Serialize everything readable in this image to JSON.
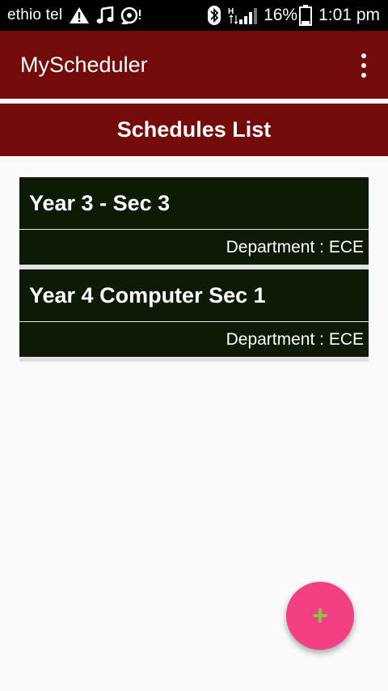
{
  "status_bar": {
    "carrier": "ethio tel",
    "network_type": "H",
    "battery_percent": "16%",
    "time": "1:01 pm",
    "icons": [
      "warning-icon",
      "music-icon",
      "sync-icon",
      "bluetooth-icon",
      "signal-icon",
      "battery-icon"
    ]
  },
  "app_bar": {
    "title": "MyScheduler",
    "overflow_icon": "more-vertical-icon"
  },
  "section": {
    "title": "Schedules List"
  },
  "schedules": [
    {
      "title": "Year 3 - Sec 3",
      "department": "Department : ECE"
    },
    {
      "title": "Year 4 Computer Sec 1",
      "department": "Department : ECE"
    }
  ],
  "fab": {
    "label": "+",
    "icon": "add-icon"
  },
  "colors": {
    "app_bar": "#730b0b",
    "card": "#0c1a06",
    "fab": "#f33f83",
    "fab_icon": "#8cc63f",
    "background": "#fafafa"
  }
}
